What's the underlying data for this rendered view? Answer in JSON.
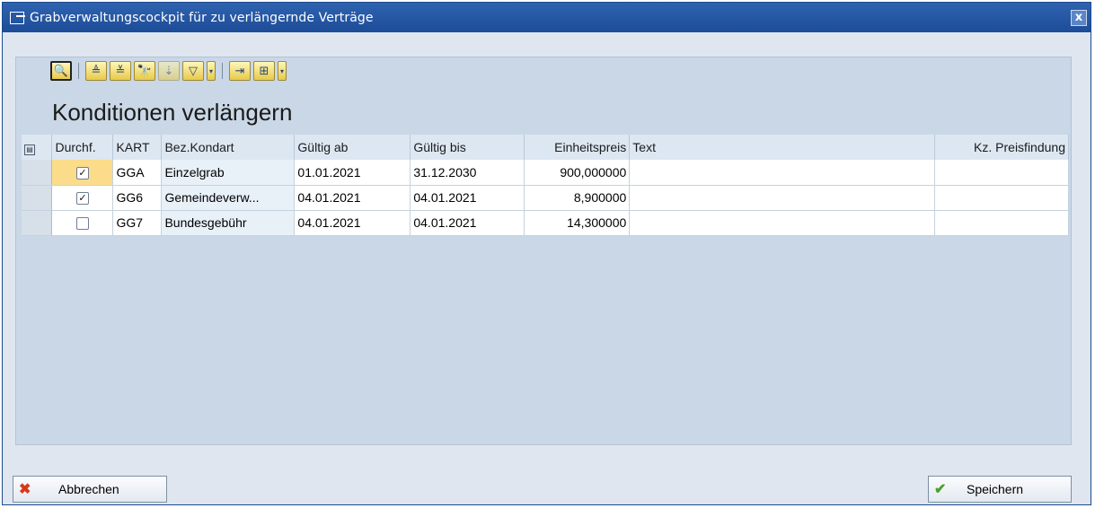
{
  "window": {
    "title": "Grabverwaltungscockpit für zu verlängernde Verträge",
    "close_label": "x"
  },
  "toolbar": {
    "buttons": [
      {
        "name": "details-icon",
        "glyph": "🔍"
      },
      {
        "name": "sort-ascending-icon",
        "glyph": "≜"
      },
      {
        "name": "sort-descending-icon",
        "glyph": "≚"
      },
      {
        "name": "find-icon",
        "glyph": "🔭"
      },
      {
        "name": "find-next-icon",
        "glyph": "⇣"
      },
      {
        "name": "filter-icon",
        "glyph": "▽"
      },
      {
        "name": "export-icon",
        "glyph": "⇥"
      },
      {
        "name": "layout-icon",
        "glyph": "⊞"
      }
    ]
  },
  "heading": "Konditionen verlängern",
  "grid": {
    "columns": [
      "Durchf.",
      "KART",
      "Bez.Kondart",
      "Gültig ab",
      "Gültig bis",
      "Einheitspreis",
      "Text",
      "Kz. Preisfindung"
    ],
    "rows": [
      {
        "durchf": true,
        "kart": "GGA",
        "bez": "Einzelgrab",
        "ab": "01.01.2021",
        "bis": "31.12.2030",
        "preis": "900,000000",
        "text": "",
        "kz": ""
      },
      {
        "durchf": true,
        "kart": "GG6",
        "bez": "Gemeindeverw...",
        "ab": "04.01.2021",
        "bis": "04.01.2021",
        "preis": "8,900000",
        "text": "",
        "kz": ""
      },
      {
        "durchf": false,
        "kart": "GG7",
        "bez": "Bundesgebühr",
        "ab": "04.01.2021",
        "bis": "04.01.2021",
        "preis": "14,300000",
        "text": "",
        "kz": ""
      }
    ]
  },
  "buttons": {
    "cancel": "Abbrechen",
    "save": "Speichern"
  },
  "colors": {
    "titlebar": "#1d4c97",
    "panel": "#c9d7e6",
    "checkbox_focus": "#fbdc8a",
    "cancel_icon": "#d63a1a",
    "save_icon": "#4aa12c"
  }
}
